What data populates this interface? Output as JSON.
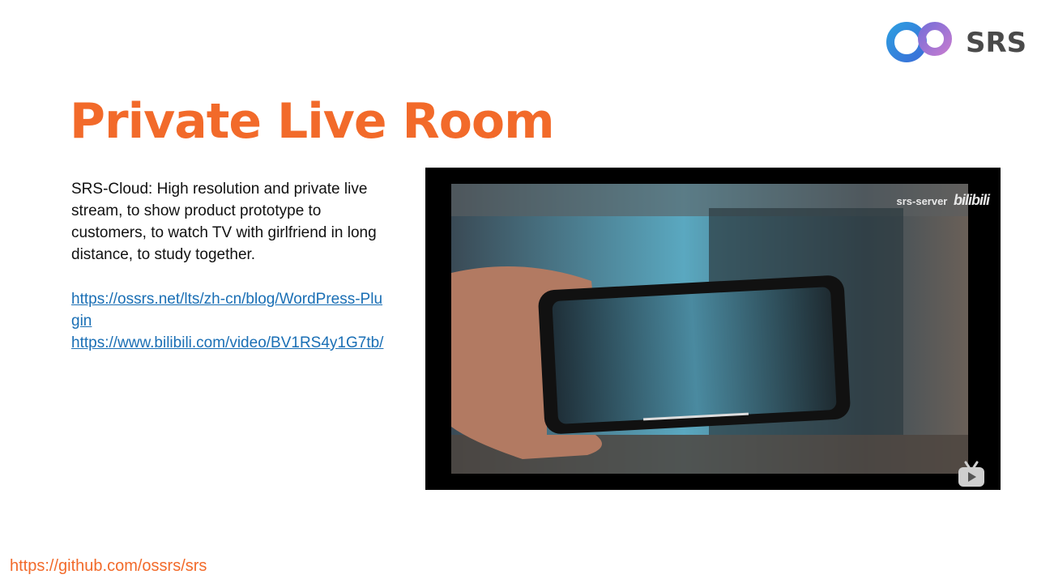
{
  "logo": {
    "text": "SRS",
    "icon": "infinity-logo-icon"
  },
  "title": "Private Live Room",
  "description": "SRS-Cloud: High resolution and private live stream, to show product prototype to customers, to watch TV with girlfriend in long distance, to study together.",
  "links": [
    "https://ossrs.net/lts/zh-cn/blog/WordPress-Plugin",
    "https://www.bilibili.com/video/BV1RS4y1G7tb/"
  ],
  "video": {
    "watermark_text": "srs-server",
    "watermark_brand": "bilibili",
    "icon": "play-tv-icon"
  },
  "footer": "https://github.com/ossrs/srs",
  "colors": {
    "accent": "#f26a2a",
    "link": "#1a6fb5"
  }
}
